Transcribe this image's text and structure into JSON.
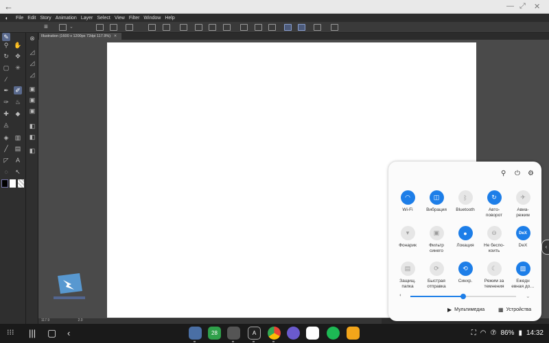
{
  "menu": {
    "items": [
      "File",
      "Edit",
      "Story",
      "Animation",
      "Layer",
      "Select",
      "View",
      "Filter",
      "Window",
      "Help"
    ]
  },
  "document": {
    "tab_title": "Illustration (1600 x 1200px 72dpi 117.9%)"
  },
  "status": {
    "zoom": "117.9",
    "rotation": "2.0"
  },
  "quick_settings": {
    "tiles": [
      {
        "label": "Wi-Fi",
        "state": "on",
        "icon": "wifi-icon"
      },
      {
        "label": "Вибрация",
        "state": "on",
        "icon": "vibrate-icon"
      },
      {
        "label": "Bluetooth",
        "state": "off",
        "icon": "bluetooth-icon"
      },
      {
        "label": "Авто-\nповорот",
        "state": "on",
        "icon": "autorotate-icon"
      },
      {
        "label": "Авиа-\nрежим",
        "state": "off",
        "icon": "airplane-icon"
      },
      {
        "label": "Фонарик",
        "state": "off",
        "icon": "flashlight-icon"
      },
      {
        "label": "Фильтр\nсинего",
        "state": "off",
        "icon": "blue-filter-icon"
      },
      {
        "label": "Локация",
        "state": "on",
        "icon": "location-icon"
      },
      {
        "label": "Не беспо-\nкоить",
        "state": "off",
        "icon": "dnd-icon"
      },
      {
        "label": "DeX",
        "state": "on",
        "icon": "dex-icon"
      },
      {
        "label": "Защищ.\nпапка",
        "state": "off",
        "icon": "secure-folder-icon"
      },
      {
        "label": "Быстрая\nотправка",
        "state": "off",
        "icon": "quick-share-icon"
      },
      {
        "label": "Синхр.",
        "state": "on",
        "icon": "sync-icon"
      },
      {
        "label": "Режим за\nтемнения",
        "state": "off",
        "icon": "night-mode-icon"
      },
      {
        "label": "Ежедн\nевная до…",
        "state": "on",
        "icon": "daily-board-icon"
      }
    ],
    "brightness": 0.5,
    "media_label": "Мультимедиа",
    "devices_label": "Устройства"
  },
  "taskbar": {
    "battery": "86%",
    "time": "14:32",
    "calendar_day": "28"
  },
  "colors": {
    "accent": "#1d7ee8",
    "tile_off": "#e6e6e6"
  }
}
